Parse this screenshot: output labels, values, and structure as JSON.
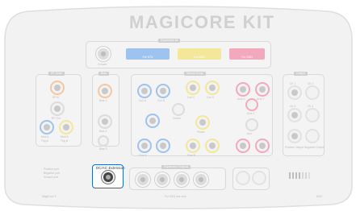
{
  "title": "MAGICORE KIT",
  "top_panel": {
    "title": "Expansion kit",
    "ground_label": "Ground"
  },
  "swatches": [
    {
      "label": "For NTS",
      "color": "#9fc3ef"
    },
    {
      "label": "For MAG",
      "color": "#f3e79a"
    },
    {
      "label": "For GND",
      "color": "#f2a9bd"
    }
  ],
  "left_panel": {
    "title": "RF Drive",
    "labels": [
      "RF In",
      "RF Out",
      "Mod A",
      "Mod B",
      "Trig A",
      "Trig B"
    ]
  },
  "mid_panel": {
    "title": "Bias",
    "labels": [
      "Bias 1",
      "Bias 2",
      "Bias 3"
    ]
  },
  "center_panel": {
    "title": "Sensor Array",
    "labels": [
      "Coil A",
      "Coil B",
      "Coil C",
      "Coil D",
      "Center",
      "Axis X",
      "Axis Y",
      "Axis Z",
      "Phase",
      "Aux",
      "Fine A",
      "Fine B"
    ]
  },
  "right_panel": {
    "title": "Output",
    "labels": [
      "Ch 1",
      "Ch 2",
      "Ch 3",
      "Ch 4",
      "Positive Output",
      "Negative Output"
    ]
  },
  "legend_lines": [
    "Positive port",
    "Negative port",
    "Ground port"
  ],
  "bottom_panel": {
    "title": "Expansion Outputs"
  },
  "highlight": {
    "label": "DC/AC Extension",
    "accent": "#1b6bbf"
  },
  "footer": {
    "left": "MagiCore ©",
    "center": "For R&D use only",
    "right": "MCK"
  },
  "colors": {
    "blue": "#9fc3ef",
    "yellow": "#f3e79a",
    "pink": "#f2a9bd",
    "orange": "#f5c7a0"
  }
}
